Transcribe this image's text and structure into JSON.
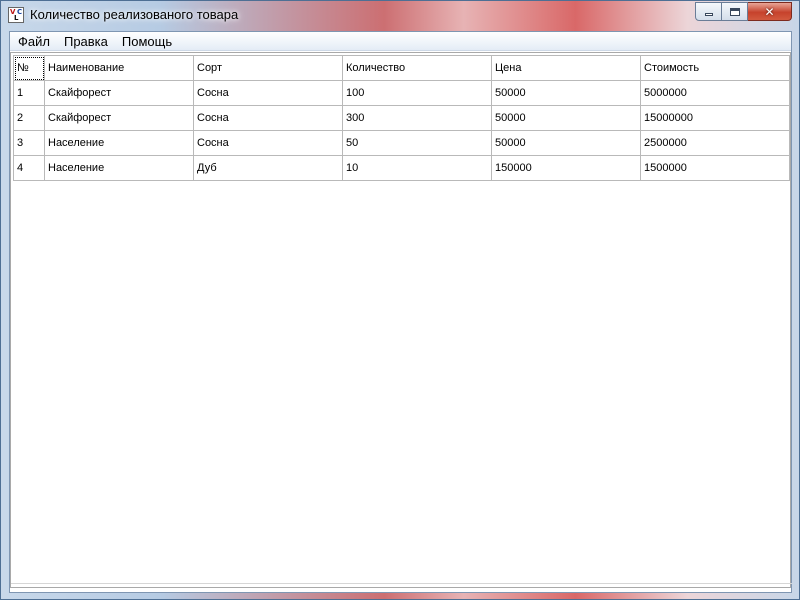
{
  "window": {
    "title": "Количество реализованого товара",
    "icon_letters": [
      "V",
      "C",
      "L"
    ]
  },
  "menu": [
    {
      "label": "Файл"
    },
    {
      "label": "Правка"
    },
    {
      "label": "Помощь"
    }
  ],
  "table": {
    "columns": [
      "№",
      "Наименование",
      "Сорт",
      "Количество",
      "Цена",
      "Стоимость"
    ],
    "rows": [
      [
        "1",
        "Скайфорест",
        "Сосна",
        "100",
        "50000",
        "5000000"
      ],
      [
        "2",
        "Скайфорест",
        "Сосна",
        "300",
        "50000",
        "15000000"
      ],
      [
        "3",
        "Население",
        "Сосна",
        "50",
        "50000",
        "2500000"
      ],
      [
        "4",
        "Население",
        "Дуб",
        "10",
        "150000",
        "1500000"
      ]
    ]
  },
  "controls": {
    "minimize_icon": "minimize-icon",
    "maximize_icon": "maximize-icon",
    "close_icon": "close-icon",
    "close_glyph": "✕"
  }
}
